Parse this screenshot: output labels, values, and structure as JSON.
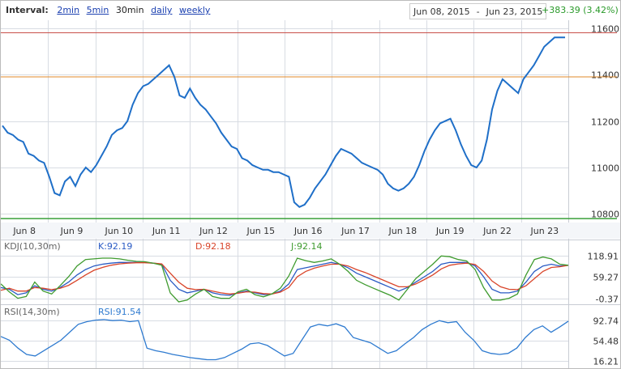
{
  "toolbar": {
    "interval_label": "Interval:",
    "intervals": [
      {
        "label": "2min",
        "selected": false
      },
      {
        "label": "5min",
        "selected": false
      },
      {
        "label": "30min",
        "selected": true
      },
      {
        "label": "daily",
        "selected": false
      },
      {
        "label": "weekly",
        "selected": false
      }
    ],
    "date_from": "Jun 08, 2015",
    "date_sep": "-",
    "date_to": "Jun 23, 2015",
    "change": "+383.39 (3.42%)"
  },
  "colors": {
    "price": "#1f6fc8",
    "k": "#2a5bc4",
    "d": "#d9452a",
    "j": "#3f9b2f",
    "rsi": "#2f7bd0",
    "resistance": "#c8504a",
    "support": "#e08a2a",
    "baseline": "#3aa03a",
    "grid": "#d8dce3"
  },
  "chart_data": [
    {
      "type": "line",
      "name": "price",
      "x_categories": [
        "Jun 8",
        "Jun 9",
        "Jun 10",
        "Jun 11",
        "Jun 12",
        "Jun 15",
        "Jun 16",
        "Jun 17",
        "Jun 18",
        "Jun 19",
        "Jun 22",
        "Jun 23"
      ],
      "yticks": [
        10800,
        11000,
        11200,
        11400,
        11600
      ],
      "ylim": [
        10770,
        11620
      ],
      "hlines": {
        "resistance": 11580,
        "support": 11390,
        "baseline": 10780
      },
      "series": [
        {
          "values": [
            11180,
            11150,
            11140,
            11120,
            11110,
            11060,
            11050,
            11030,
            11020,
            10960,
            10890,
            10880,
            10940,
            10960,
            10920,
            10970,
            11000,
            10980,
            11010,
            11050,
            11090,
            11140,
            11160,
            11170,
            11200,
            11270,
            11320,
            11350,
            11360,
            11380,
            11400,
            11420,
            11440,
            11390,
            11310,
            11300,
            11340,
            11300,
            11270,
            11250,
            11220,
            11190,
            11150,
            11120,
            11090,
            11080,
            11040,
            11030,
            11010,
            11000,
            10990,
            10990,
            10980,
            10980,
            10970,
            10960,
            10850,
            10830,
            10840,
            10870,
            10910,
            10940,
            10970,
            11010,
            11050,
            11080,
            11070,
            11060,
            11040,
            11020,
            11010,
            11000,
            10990,
            10970,
            10930,
            10910,
            10900,
            10910,
            10930,
            10960,
            11010,
            11070,
            11120,
            11160,
            11190,
            11200,
            11210,
            11160,
            11100,
            11050,
            11010,
            11000,
            11030,
            11120,
            11250,
            11330,
            11380,
            11360,
            11340,
            11320,
            11380,
            11410,
            11440,
            11480,
            11520,
            11540,
            11560,
            11560,
            11560
          ]
        }
      ]
    },
    {
      "type": "line",
      "name": "KDJ",
      "label": "KDJ(10,30m)",
      "yticks": [
        118.91,
        59.27,
        -0.37
      ],
      "ylim": [
        -10,
        130
      ],
      "legend": {
        "k": "K:92.19",
        "d": "D:92.18",
        "j": "J:92.14"
      },
      "series": [
        {
          "name": "K",
          "values": [
            30,
            25,
            10,
            15,
            35,
            25,
            20,
            30,
            45,
            65,
            80,
            90,
            95,
            98,
            100,
            100,
            100,
            100,
            98,
            95,
            50,
            25,
            15,
            20,
            25,
            15,
            10,
            8,
            15,
            20,
            15,
            10,
            12,
            20,
            40,
            80,
            85,
            90,
            95,
            100,
            95,
            85,
            70,
            60,
            50,
            40,
            30,
            20,
            30,
            45,
            60,
            75,
            95,
            100,
            100,
            100,
            90,
            60,
            25,
            15,
            15,
            20,
            45,
            75,
            90,
            95,
            90,
            92
          ]
        },
        {
          "name": "D",
          "values": [
            22,
            28,
            20,
            20,
            30,
            28,
            24,
            28,
            36,
            50,
            65,
            78,
            86,
            92,
            96,
            98,
            99,
            99,
            98,
            96,
            70,
            45,
            28,
            24,
            25,
            20,
            15,
            12,
            14,
            18,
            17,
            13,
            12,
            17,
            30,
            60,
            75,
            84,
            90,
            95,
            95,
            90,
            80,
            72,
            62,
            52,
            42,
            32,
            32,
            40,
            52,
            65,
            82,
            92,
            96,
            98,
            94,
            75,
            48,
            32,
            25,
            24,
            35,
            55,
            75,
            86,
            88,
            92
          ]
        },
        {
          "name": "J",
          "values": [
            40,
            18,
            0,
            5,
            45,
            20,
            12,
            35,
            60,
            90,
            108,
            110,
            112,
            112,
            110,
            106,
            103,
            102,
            98,
            92,
            15,
            -10,
            -5,
            12,
            25,
            5,
            0,
            0,
            18,
            25,
            10,
            4,
            12,
            28,
            62,
            112,
            105,
            100,
            104,
            110,
            95,
            75,
            50,
            38,
            28,
            18,
            8,
            -5,
            25,
            55,
            75,
            95,
            118,
            116,
            108,
            104,
            80,
            30,
            -5,
            -5,
            0,
            12,
            65,
            108,
            115,
            110,
            95,
            92
          ]
        }
      ]
    },
    {
      "type": "line",
      "name": "RSI",
      "label": "RSI(14,30m)",
      "yticks": [
        92.74,
        54.48,
        16.21
      ],
      "ylim": [
        5,
        100
      ],
      "legend": "RSI:91.54",
      "series": [
        {
          "name": "RSI",
          "values": [
            62,
            55,
            40,
            28,
            25,
            35,
            45,
            55,
            70,
            85,
            90,
            93,
            94,
            92,
            93,
            90,
            92,
            40,
            35,
            32,
            28,
            25,
            22,
            20,
            18,
            18,
            22,
            30,
            38,
            48,
            50,
            45,
            35,
            25,
            30,
            55,
            80,
            85,
            82,
            86,
            80,
            60,
            55,
            50,
            40,
            30,
            35,
            48,
            60,
            75,
            85,
            92,
            88,
            90,
            70,
            55,
            35,
            30,
            28,
            30,
            40,
            60,
            75,
            82,
            70,
            80,
            91
          ]
        }
      ]
    }
  ]
}
